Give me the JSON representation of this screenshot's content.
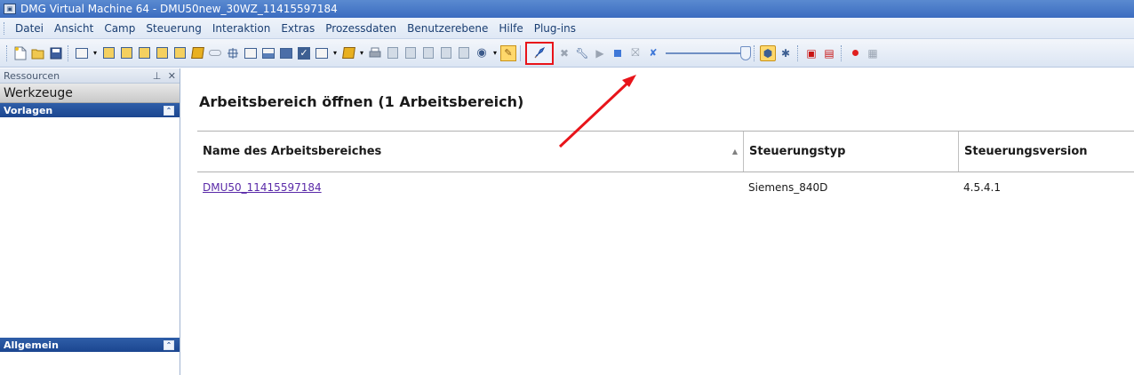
{
  "window": {
    "title": "DMG Virtual Machine 64 - DMU50new_30WZ_11415597184"
  },
  "menu": [
    "Datei",
    "Ansicht",
    "Camp",
    "Steuerung",
    "Interaktion",
    "Extras",
    "Prozessdaten",
    "Benutzerebene",
    "Hilfe",
    "Plug-ins"
  ],
  "left_panel": {
    "header": "Ressourcen",
    "tab": "Werkzeuge",
    "group_top": "Vorlagen",
    "group_bottom": "Allgemein"
  },
  "main": {
    "title": "Arbeitsbereich öffnen (1 Arbeitsbereich)",
    "columns": [
      "Name des Arbeitsbereiches",
      "Steuerungstyp",
      "Steuerungsversion"
    ],
    "rows": [
      {
        "name": "DMU50_11415597184",
        "control_type": "Siemens_840D",
        "control_version": "4.5.4.1"
      }
    ]
  },
  "colors": {
    "highlight": "#e8141a",
    "title_bar": "#3b6cc0",
    "link": "#5a2aa8"
  }
}
